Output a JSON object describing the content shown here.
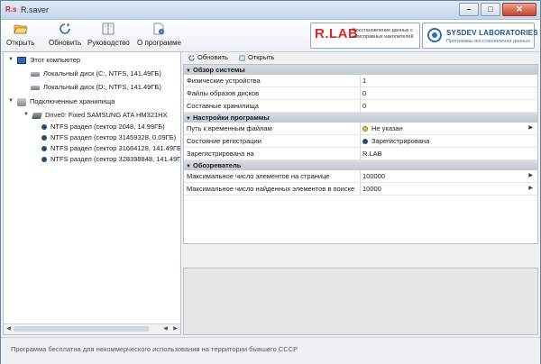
{
  "window": {
    "logo": "R.s",
    "title": "R.saver"
  },
  "toolbar": {
    "open_label": "Открыть",
    "refresh_label": "Обновить",
    "manual_label": "Руководство",
    "about_label": "О программе",
    "rlab_banner": {
      "logo_text": "R.LAB",
      "text": "Восстановление данных с неисправных накопителей"
    },
    "sysdev_banner": {
      "name": "SYSDEV LABORATORIES",
      "subtitle": "Программы восстановления данных"
    }
  },
  "tree": {
    "computer": {
      "label": "Этот компьютер",
      "items": [
        "Локальный диск (C:, NTFS, 141.49ГБ)",
        "Локальный диск (D:, NTFS, 141.49ГБ)"
      ]
    },
    "storages": {
      "label": "Подключенные хранилища",
      "drive": "Drive0: Fixed SAMSUNG ATA HM321HX",
      "partitions": [
        "NTFS раздел (сектор 2048, 14.99ГБ)",
        "NTFS раздел (сектор 31459328, 0.09ГБ)",
        "NTFS раздел (сектор 31664128, 141.49ГБ)",
        "NTFS раздел (сектор 328398848, 141.49ГБ)"
      ]
    }
  },
  "right_toolbar": {
    "refresh_label": "Обновить",
    "open_label": "Открыть"
  },
  "grid": {
    "sections": [
      {
        "title": "Обзор системы",
        "rows": [
          {
            "key": "Физические устройства",
            "value": "1"
          },
          {
            "key": "Файлы образов дисков",
            "value": "0"
          },
          {
            "key": "Составные хранилища",
            "value": "0"
          }
        ]
      },
      {
        "title": "Настройки программы",
        "rows": [
          {
            "key": "Путь к временным файлам",
            "value": "Не указан"
          },
          {
            "key": "Состояние регистрации",
            "value": "Зарегистрирована"
          },
          {
            "key": "Зарегистрирована на",
            "value": "R.LAB"
          }
        ]
      },
      {
        "title": "Обозреватель",
        "rows": [
          {
            "key": "Максимальное число элементов на странице",
            "value": "100000"
          },
          {
            "key": "Максимальное число найденных элементов в поиске",
            "value": "10000"
          }
        ]
      }
    ]
  },
  "status": {
    "text": "Программа бесплатна для некоммерческого использования на территории бывшего СССР"
  }
}
